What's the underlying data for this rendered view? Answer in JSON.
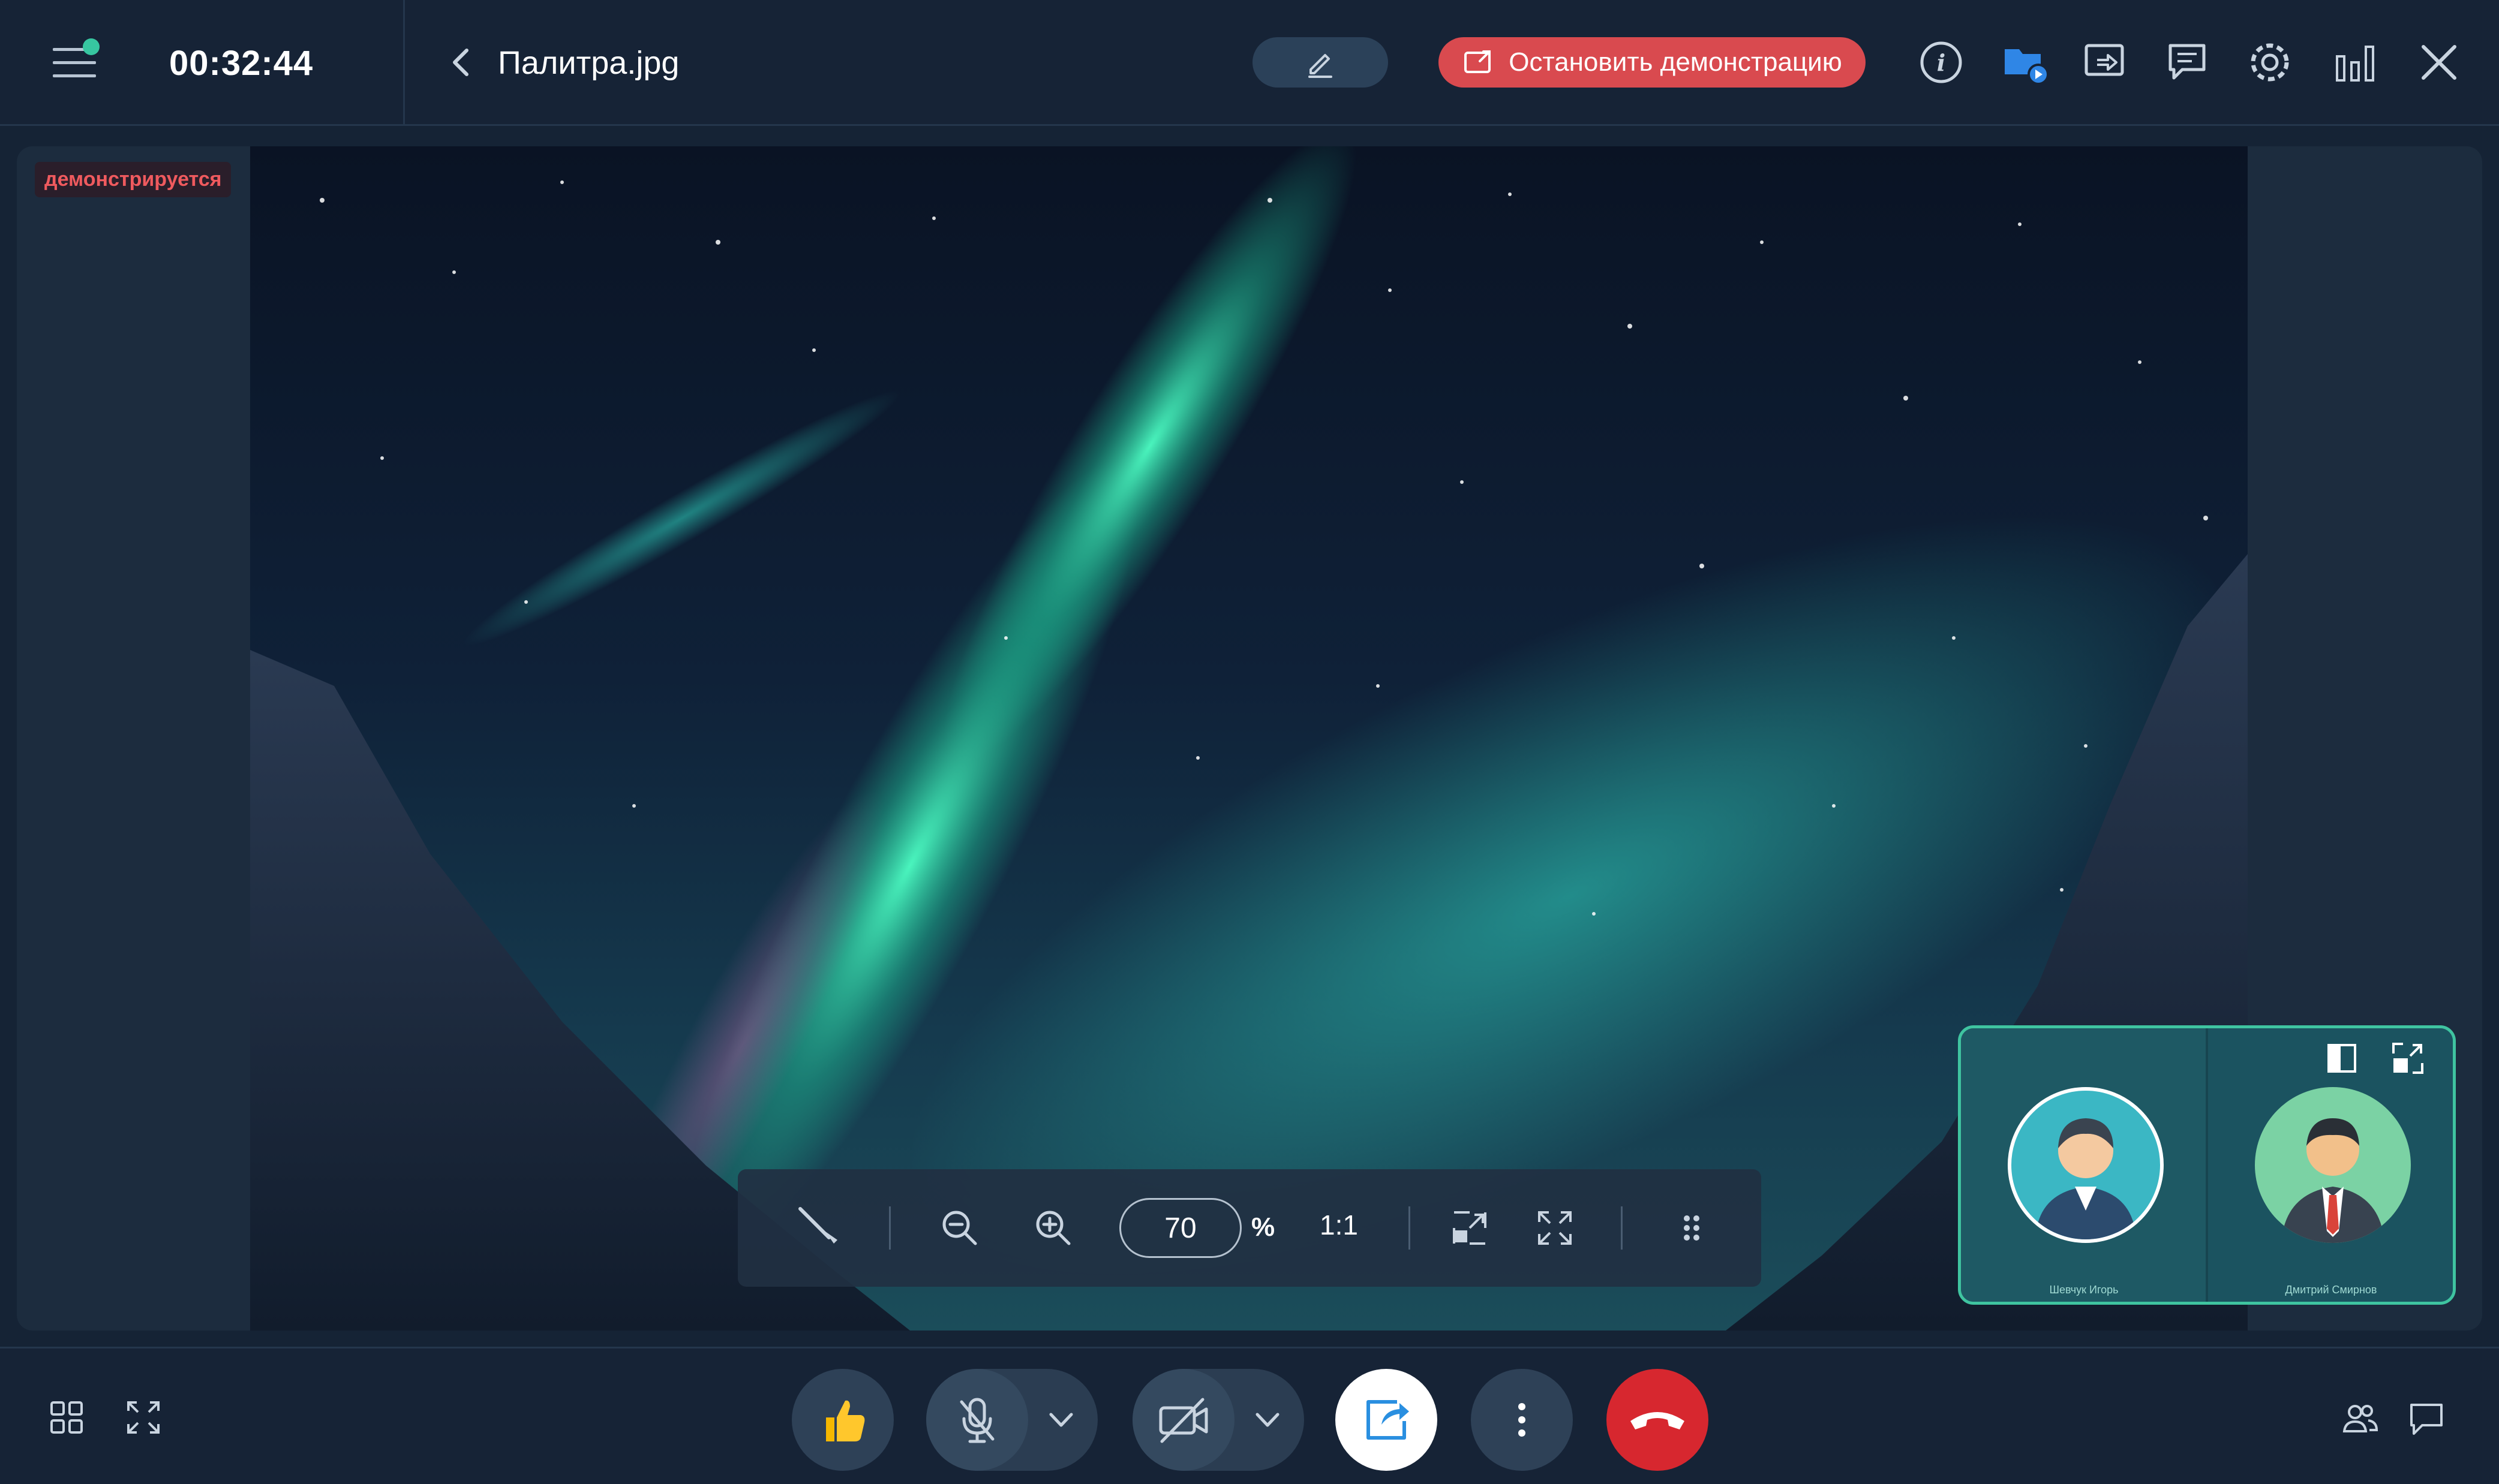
{
  "app": {
    "timer": "00:32:44",
    "file_name": "Палитра.jpg",
    "stop_demo_label": "Остановить демонстрацию"
  },
  "colors": {
    "accent": "#37c6a0",
    "danger": "#d94a4f",
    "background": "#152335",
    "panel": "#1c2c3e"
  },
  "top_icons": [
    "info-icon",
    "shared-files-icon",
    "screen-share-icon",
    "chat-icon",
    "settings-icon",
    "stats-icon",
    "close-icon"
  ],
  "stage": {
    "badge": "демонстрируется",
    "image_name": "Палитра.jpg"
  },
  "viewer_toolbar": {
    "zoom_value": "70",
    "zoom_unit": "%",
    "ratio_label": "1:1",
    "icons": [
      "pointer-icon",
      "zoom-out-icon",
      "zoom-in-icon",
      "fit-screen-icon",
      "fullscreen-icon",
      "drag-handle-icon"
    ]
  },
  "participants": [
    {
      "name": "Шевчук Игорь"
    },
    {
      "name": "Дмитрий Смирнов"
    }
  ],
  "bottom_bar": {
    "left_icons": [
      "grid-view-icon",
      "fullscreen-icon"
    ],
    "center_buttons": [
      "reaction-icon",
      "microphone-off-icon",
      "camera-off-icon",
      "share-screen-icon",
      "more-icon",
      "hang-up-icon"
    ],
    "right_icons": [
      "participants-icon",
      "chat-icon"
    ]
  }
}
